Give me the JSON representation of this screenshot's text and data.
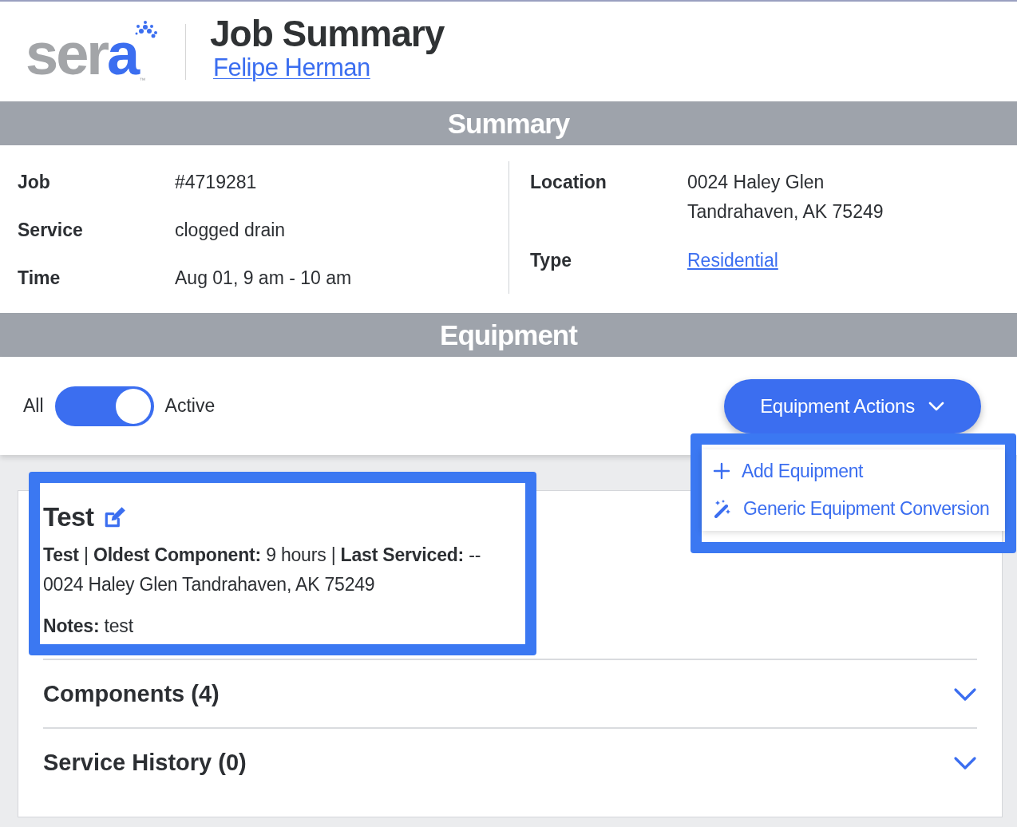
{
  "logo": {
    "text": "ser",
    "accent_text": "a",
    "trademark": "™"
  },
  "header": {
    "title": "Job Summary",
    "customer": "Felipe Herman"
  },
  "summary": {
    "title": "Summary",
    "left": [
      {
        "label": "Job",
        "value": "#4719281"
      },
      {
        "label": "Service",
        "value": "clogged drain"
      },
      {
        "label": "Time",
        "value": "Aug 01, 9 am - 10 am"
      }
    ],
    "right": [
      {
        "label": "Location",
        "lines": [
          "0024 Haley Glen",
          "Tandrahaven, AK 75249"
        ]
      },
      {
        "label": "Type",
        "link": "Residential"
      }
    ]
  },
  "equipment": {
    "title": "Equipment",
    "filter": {
      "off_label": "All",
      "on_label": "Active",
      "on": true
    },
    "actions": {
      "label": "Equipment Actions",
      "expanded": true,
      "highlighted": true,
      "items": [
        {
          "kind": "add",
          "label": "Add Equipment"
        },
        {
          "kind": "convert",
          "label": "Generic Equipment Conversion"
        }
      ]
    },
    "card": {
      "name": "Test",
      "highlighted": true,
      "info": "**Test** | **Oldest Component:** 9 hours | **Last Serviced:** --",
      "address": "0024 Haley Glen Tandrahaven, AK 75249",
      "notes": "**Notes:** test",
      "sections": [
        {
          "label": "Components (4)",
          "expanded": false
        },
        {
          "label": "Service History (0)",
          "expanded": false
        }
      ]
    }
  }
}
